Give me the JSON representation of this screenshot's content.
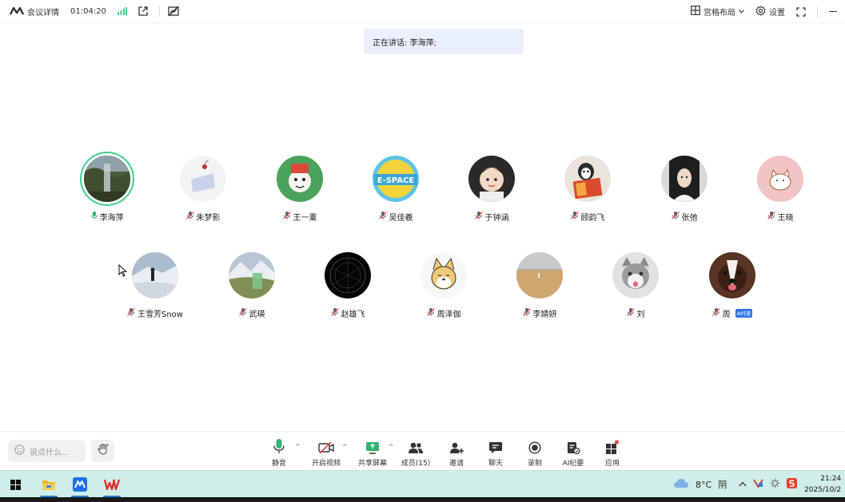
{
  "topbar": {
    "meeting_details": "会议详情",
    "timer": "01:04:20",
    "layout_label": "宫格布局",
    "settings_label": "设置"
  },
  "speaking": {
    "text": "正在讲话: 李海萍;"
  },
  "participants_row1": [
    {
      "name": "李海萍",
      "mic": "on",
      "avatar": "waterfall"
    },
    {
      "name": "朱梦影",
      "mic": "muted",
      "avatar": "cake"
    },
    {
      "name": "王一粟",
      "mic": "muted",
      "avatar": "cartoon-green"
    },
    {
      "name": "吴佳羲",
      "mic": "muted",
      "avatar": "e-space"
    },
    {
      "name": "于钟涵",
      "mic": "muted",
      "avatar": "child"
    },
    {
      "name": "顾韵飞",
      "mic": "muted",
      "avatar": "penguin-book"
    },
    {
      "name": "张弛",
      "mic": "muted",
      "avatar": "girl"
    },
    {
      "name": "王晓",
      "mic": "muted",
      "avatar": "pink-cat"
    }
  ],
  "participants_row2": [
    {
      "name": "王雪芳Snow",
      "mic": "muted",
      "avatar": "snow-hiker"
    },
    {
      "name": "武瑛",
      "mic": "muted",
      "avatar": "mountain"
    },
    {
      "name": "赵雄飞",
      "mic": "muted",
      "avatar": "dark-circle"
    },
    {
      "name": "周泽伽",
      "mic": "muted",
      "avatar": "shiba"
    },
    {
      "name": "李婧妍",
      "mic": "muted",
      "avatar": "field"
    },
    {
      "name": "刘",
      "mic": "muted",
      "avatar": "cat"
    },
    {
      "name": "周",
      "mic": "muted",
      "avatar": "dog",
      "badge": "AI托管"
    }
  ],
  "bottombar": {
    "chat_placeholder": "说点什么...",
    "tools": [
      {
        "label": "静音",
        "icon": "mic-icon"
      },
      {
        "label": "开启视频",
        "icon": "video-off-icon"
      },
      {
        "label": "共享屏幕",
        "icon": "share-screen-icon"
      },
      {
        "label": "成员(15)",
        "icon": "members-icon"
      },
      {
        "label": "邀请",
        "icon": "invite-icon"
      },
      {
        "label": "聊天",
        "icon": "chat-icon"
      },
      {
        "label": "录制",
        "icon": "record-icon"
      },
      {
        "label": "AI纪要",
        "icon": "ai-notes-icon"
      },
      {
        "label": "应用",
        "icon": "apps-icon"
      }
    ]
  },
  "taskbar": {
    "weather_temp": "8°C",
    "weather_desc": "阴",
    "time": "21:24",
    "date": "2025/10/2"
  },
  "colors": {
    "accent_green": "#3fce8f",
    "speaking_bg": "#eaf0fb",
    "taskbar_bg": "#cfeee8",
    "mute_red": "#e24b4b"
  }
}
